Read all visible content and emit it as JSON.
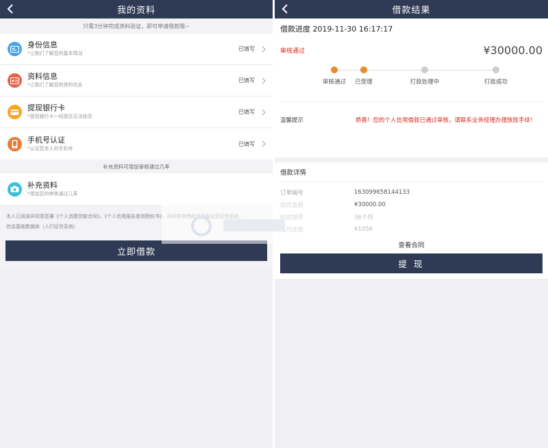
{
  "left": {
    "title": "我的资料",
    "notice": "只需3分钟完成资料验证，即可申请借款哦~",
    "items": [
      {
        "title": "身份信息",
        "sub": "*让我们了解您的基本情况",
        "status": "已填写",
        "icon": "id-card-icon",
        "color": "#4aa3ef"
      },
      {
        "title": "资料信息",
        "sub": "*让我们了解您的资料信息",
        "status": "已填写",
        "icon": "info-card-icon",
        "color": "#e8604a"
      },
      {
        "title": "提现银行卡",
        "sub": "*提现银行卡一经提交无法修改",
        "status": "已填写",
        "icon": "bank-card-icon",
        "color": "#f5a623"
      },
      {
        "title": "手机号认证",
        "sub": "*认证您本人的手机号",
        "status": "已填写",
        "icon": "phone-icon",
        "color": "#e57c3c"
      }
    ],
    "sub_notice": "补充资料可增加审核通过几率",
    "extra_item": {
      "title": "补充资料",
      "sub": "*增加您的审核通过几率",
      "icon": "camera-icon",
      "color": "#3cc0d8"
    },
    "agreement": "本人已阅读并同意签署《个人消费贷款合同》、《个人信用报告查询授权书》，并同意将借款信息报送至征信系统，",
    "agreement_line2": "信息基础数据库（人行征信系统）",
    "button": "立即借款"
  },
  "right": {
    "title": "借款结果",
    "progress_label": "借款进度 2019-11-30 16:17:17",
    "status": "审核通过",
    "amount": "¥30000.00",
    "steps": [
      {
        "label": "审核通过",
        "color": "#f08a24"
      },
      {
        "label": "已受理",
        "color": "#f08a24"
      },
      {
        "label": "打款处理中",
        "color": "#cccccc"
      },
      {
        "label": "打款成功",
        "color": "#cccccc"
      }
    ],
    "warm_label": "温馨提示",
    "warm_msg": "恭喜！您的个人信用借款已通过审核，请联系业务经理办理放款手续！",
    "detail_head": "借款详情",
    "details": [
      {
        "k": "订单编号",
        "v": "163099658144133"
      },
      {
        "k": "借款金额",
        "v": "¥30000.00"
      },
      {
        "k": "借款期限",
        "v": "36个月"
      },
      {
        "k": "每月还款",
        "v": "¥1056"
      }
    ],
    "contract": "查看合同",
    "button": "提 现"
  },
  "colors": {
    "header": "#2f3a55",
    "accent_orange": "#f08a24",
    "accent_red": "#e0251a"
  }
}
